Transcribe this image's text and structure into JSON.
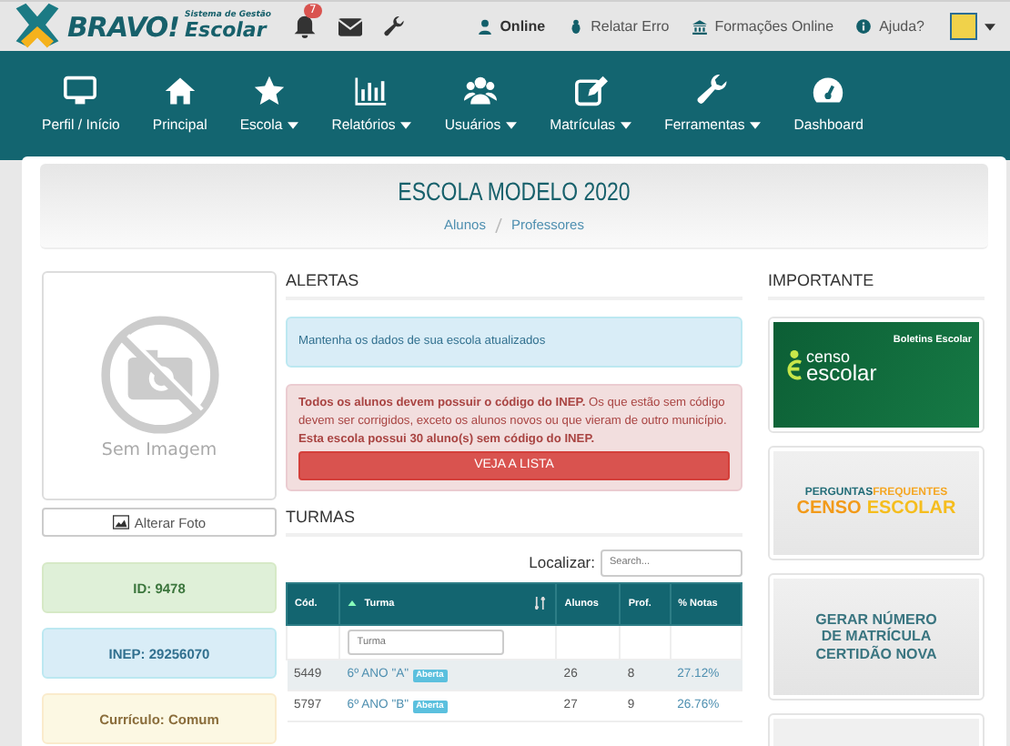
{
  "top_bar": {
    "logo": {
      "brand": "BRAVO!",
      "tagline": "Sistema de Gestão",
      "product": "Escolar"
    },
    "notification_count": "7",
    "links": [
      {
        "label": "Online",
        "kind": "user"
      },
      {
        "label": "Relatar Erro",
        "kind": "bug"
      },
      {
        "label": "Formações Online",
        "kind": "bank"
      },
      {
        "label": "Ajuda?",
        "kind": "info"
      }
    ]
  },
  "nav": {
    "items": [
      {
        "label": "Perfil / Início",
        "kind": "monitor",
        "dropdown": false
      },
      {
        "label": "Principal",
        "kind": "home",
        "dropdown": false
      },
      {
        "label": "Escola",
        "kind": "star",
        "dropdown": true
      },
      {
        "label": "Relatórios",
        "kind": "chart",
        "dropdown": true
      },
      {
        "label": "Usuários",
        "kind": "users",
        "dropdown": true
      },
      {
        "label": "Matrículas",
        "kind": "edit",
        "dropdown": true
      },
      {
        "label": "Ferramentas",
        "kind": "wrench",
        "dropdown": true
      },
      {
        "label": "Dashboard",
        "kind": "gauge",
        "dropdown": false
      }
    ]
  },
  "page": {
    "title": "ESCOLA MODELO 2020",
    "breadcrumb": [
      "Alunos",
      "Professores"
    ]
  },
  "profile": {
    "photo_caption": "Sem Imagem",
    "change_photo_button": "Alterar Foto",
    "info_boxes": [
      {
        "text": "ID: 9478",
        "kind": "success"
      },
      {
        "text": "INEP: 29256070",
        "kind": "info"
      },
      {
        "text": "Currículo: Comum",
        "kind": "warning"
      }
    ]
  },
  "alerts": {
    "heading": "ALERTAS",
    "items": [
      {
        "kind": "info",
        "text": "Mantenha os dados de sua escola atualizados"
      },
      {
        "kind": "danger",
        "text": "**Todos os alunos devem possuir o código do INEP.** Os que estão sem código devem ser corrigidos, exceto os alunos novos ou que vieram de outro município. **Esta escola possui 30 aluno(s) sem código do INEP.**",
        "button": "VEJA A LISTA"
      }
    ]
  },
  "classes": {
    "heading": "TURMAS",
    "search_label": "Localizar:",
    "search_placeholder": "Search...",
    "filter_placeholder": "Turma",
    "columns": [
      "Cód.",
      "Turma",
      "Alunos",
      "Prof.",
      "% Notas"
    ],
    "rows": [
      {
        "code": "5449",
        "name": "6º ANO \"A\"",
        "badge": "Aberta",
        "students": "26",
        "teachers": "8",
        "grades": "27.12%"
      },
      {
        "code": "5797",
        "name": "6º ANO \"B\"",
        "badge": "Aberta",
        "students": "27",
        "teachers": "9",
        "grades": "26.76%"
      }
    ]
  },
  "important": {
    "heading": "IMPORTANTE",
    "banners": [
      {
        "kind": "census",
        "title": "Boletins Escolar",
        "line_1": "censo",
        "line_2": "escolar"
      },
      {
        "kind": "faq",
        "line_1": "PERGUNTAS",
        "line_1b": "FREQUENTES",
        "line_2": "CENSO",
        "line_2b": "ESCOLAR"
      },
      {
        "kind": "text",
        "lines": [
          "GERAR NÚMERO",
          "DE MATRÍCULA",
          "CERTIDÃO NOVA"
        ]
      },
      {
        "kind": "blank"
      }
    ]
  }
}
